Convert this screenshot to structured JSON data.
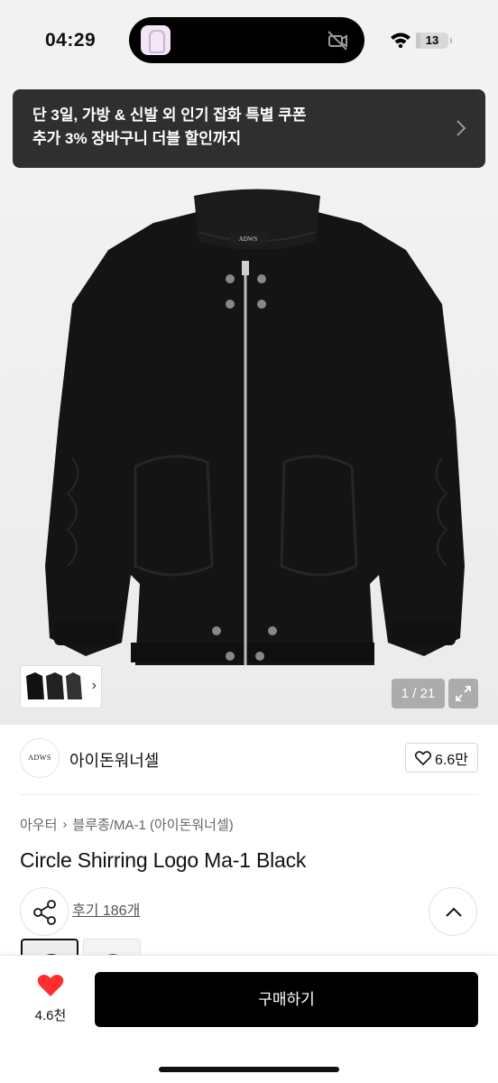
{
  "status": {
    "time": "04:29",
    "battery": "13",
    "battery_level": 0.13
  },
  "banner": {
    "line1": "단 3일, 가방 & 신발 외 인기 잡화 특별 쿠폰",
    "line2": "추가 3% 장바구니 더블 할인까지"
  },
  "gallery": {
    "counter": "1 / 21",
    "logo_text": "ADWS"
  },
  "brand": {
    "logo": "ADWS",
    "name": "아이돈워너셀",
    "likes": "6.6만"
  },
  "breadcrumb": {
    "category": "아우터",
    "separator": "›",
    "subcategory": "블루종/MA-1 (아이돈워너셀)"
  },
  "product": {
    "title": "Circle Shirring Logo Ma-1 Black",
    "reviews": "후기 186개"
  },
  "bottom": {
    "heart_count": "4.6천",
    "buy_label": "구매하기"
  },
  "colors": {
    "heart": "#ff2d2d",
    "buy_button": "#000000",
    "banner": "#2f2f2f"
  },
  "icons": [
    "app-icon",
    "camera-off-icon",
    "wifi-icon",
    "battery-icon",
    "chevron-right-icon",
    "expand-icon",
    "heart-outline-icon",
    "share-icon",
    "chevron-up-icon",
    "heart-filled-icon"
  ]
}
